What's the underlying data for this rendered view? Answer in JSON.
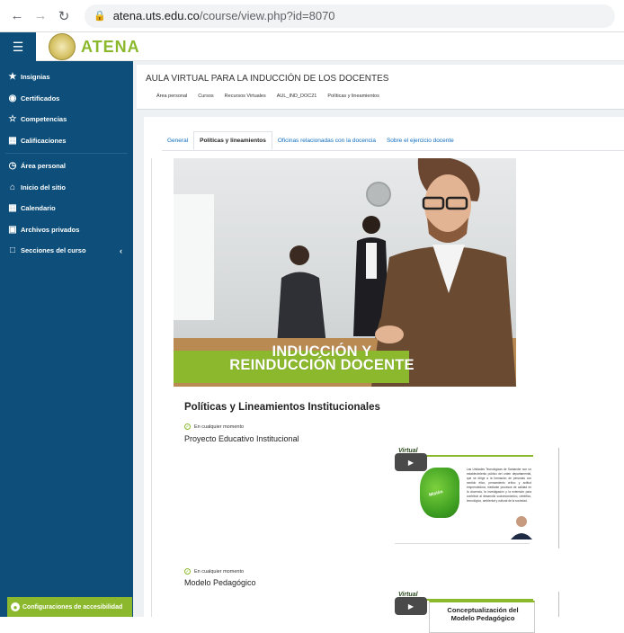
{
  "browser": {
    "url_host": "atena.uts.edu.co",
    "url_path": "/course/view.php?id=8070"
  },
  "header": {
    "logo_text": "ATENA"
  },
  "sidebar": {
    "items": [
      {
        "label": "Insignias",
        "icon": "badge-icon"
      },
      {
        "label": "Certificados",
        "icon": "certificate-icon"
      },
      {
        "label": "Competencias",
        "icon": "star-icon"
      },
      {
        "label": "Calificaciones",
        "icon": "grades-icon"
      },
      {
        "label": "Área personal",
        "icon": "dashboard-icon"
      },
      {
        "label": "Inicio del sitio",
        "icon": "home-icon"
      },
      {
        "label": "Calendario",
        "icon": "calendar-icon"
      },
      {
        "label": "Archivos privados",
        "icon": "files-icon"
      },
      {
        "label": "Secciones del curso",
        "icon": "folder-icon"
      }
    ],
    "accessibility": "Configuraciones de accesibilidad"
  },
  "course": {
    "title": "AULA VIRTUAL PARA LA INDUCCIÓN DE LOS DOCENTES",
    "breadcrumb": [
      "Área personal",
      "Cursos",
      "Recursos Virtuales",
      "AUL_IND_DOC21",
      "Políticas y lineamientos"
    ]
  },
  "tabs": [
    {
      "label": "General",
      "active": false
    },
    {
      "label": "Políticas y lineamientos",
      "active": true
    },
    {
      "label": "Oficinas relacionadas con la docencia",
      "active": false
    },
    {
      "label": "Sobre el ejercicio docente",
      "active": false
    }
  ],
  "banner": {
    "line1": "INDUCCIÓN Y",
    "line2": "REINDUCCIÓN DOCENTE"
  },
  "section": {
    "title": "Políticas y Lineamientos Institucionales",
    "resources": [
      {
        "availability": "En cualquier momento",
        "title": "Proyecto Educativo Institucional"
      },
      {
        "availability": "En cualquier momento",
        "title": "Modelo Pedagógico"
      }
    ]
  },
  "video1": {
    "brand": "Virtual",
    "puzzle_label": "Misión",
    "text": "Las Unidades Tecnológicas de Santander son un establecimiento público del orden departamental, que se dirige a la formación de personas con sentido ético, pensamiento crítico y actitud emprendedora, mediante procesos de calidad en la docencia, la investigación y la extensión para contribuir al desarrollo socioeconómico, científico, tecnológico, ambiental y cultural de la sociedad."
  },
  "video2": {
    "brand": "Virtual",
    "line1": "Conceptualización del",
    "line2": "Modelo Pedagógico"
  }
}
